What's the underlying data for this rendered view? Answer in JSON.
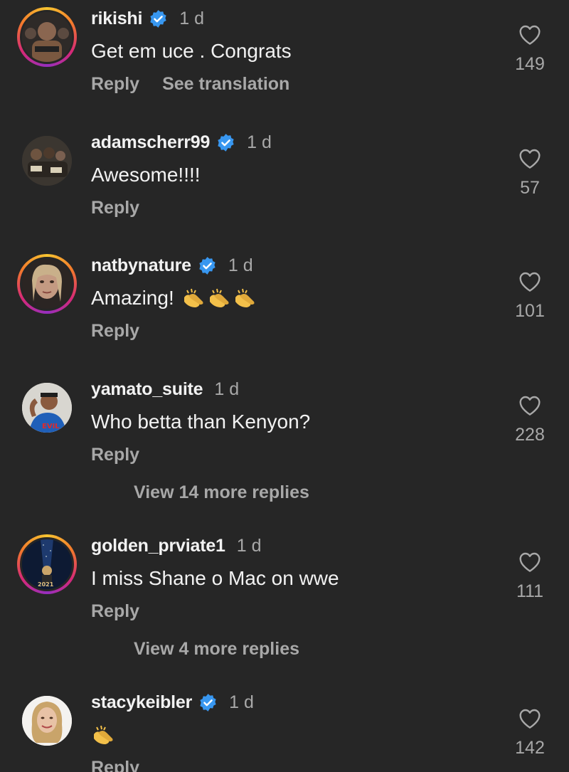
{
  "comments": [
    {
      "username": "rikishi",
      "verified": true,
      "time": "1 d",
      "text": "Get em uce . Congrats",
      "likes": "149",
      "reply_label": "Reply",
      "translate_label": "See translation",
      "ring": true
    },
    {
      "username": "adamscherr99",
      "verified": true,
      "time": "1 d",
      "text": "Awesome!!!!",
      "likes": "57",
      "reply_label": "Reply",
      "ring": false
    },
    {
      "username": "natbynature",
      "verified": true,
      "time": "1 d",
      "text": "Amazing!",
      "likes": "101",
      "reply_label": "Reply",
      "ring": true,
      "emoji": "clapping-hands x3"
    },
    {
      "username": "yamato_suite",
      "verified": false,
      "time": "1 d",
      "text": "Who betta than Kenyon?",
      "likes": "228",
      "reply_label": "Reply",
      "ring": false,
      "more_replies": "View 14 more replies"
    },
    {
      "username": "golden_prviate1",
      "verified": false,
      "time": "1 d",
      "text": "I miss Shane o Mac on wwe",
      "likes": "111",
      "reply_label": "Reply",
      "ring": true,
      "more_replies": "View 4 more replies"
    },
    {
      "username": "stacykeibler",
      "verified": true,
      "time": "1 d",
      "text": "",
      "likes": "142",
      "reply_label": "Reply",
      "ring": false,
      "emoji": "clapping-hands x1"
    }
  ],
  "icons": {
    "like": "heart-outline-icon",
    "verified": "verified-badge-icon"
  },
  "colors": {
    "background": "#262626",
    "verified": "#3897f0",
    "secondary_text": "#a8a8a8"
  }
}
